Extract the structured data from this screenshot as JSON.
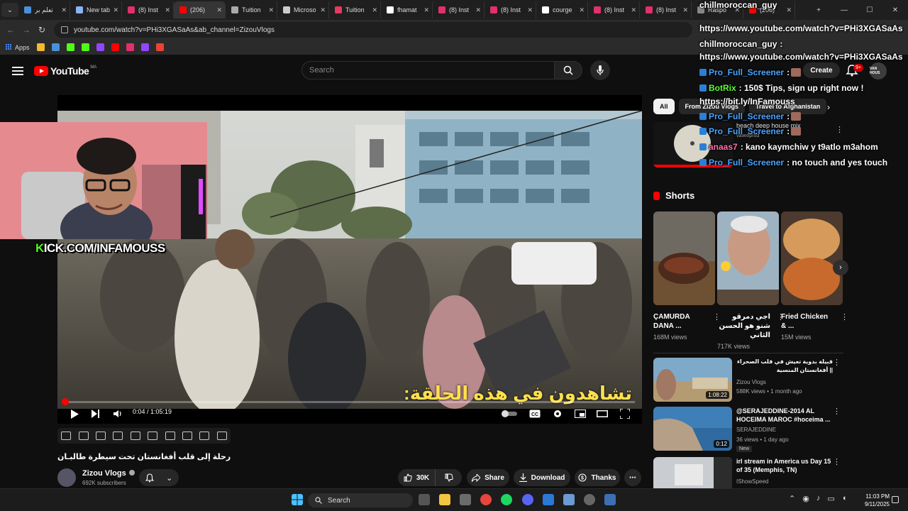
{
  "browser": {
    "tabs": [
      {
        "label": "تعلم بر",
        "color": "#4a90d9"
      },
      {
        "label": "New tab",
        "color": "#8ab4f8"
      },
      {
        "label": "(8) Inst",
        "color": "#e1306c"
      },
      {
        "label": "(206)",
        "color": "#ff0000",
        "active": true
      },
      {
        "label": "Tuition",
        "color": "#aaaaaa"
      },
      {
        "label": "Microso",
        "color": "#cccccc"
      },
      {
        "label": "Tuition",
        "color": "#e33b5f"
      },
      {
        "label": "fhamat",
        "color": "#ffffff"
      },
      {
        "label": "(8) Inst",
        "color": "#e1306c"
      },
      {
        "label": "(8) Inst",
        "color": "#e1306c"
      },
      {
        "label": "courge",
        "color": "#ffffff"
      },
      {
        "label": "(8) Inst",
        "color": "#e1306c"
      },
      {
        "label": "(8) Inst",
        "color": "#e1306c"
      },
      {
        "label": "Raspo",
        "color": "#888888"
      },
      {
        "label": "(206)",
        "color": "#ff0000"
      }
    ],
    "url": "youtube.com/watch?v=PHi3XGASaAs&ab_channel=ZizouVlogs",
    "bookmarks_apps_label": "Apps",
    "bookmark_icons": [
      "#f3ba2f",
      "#4a90d9",
      "#53fc18",
      "#53fc18",
      "#9146ff",
      "#ff0000",
      "#e1306c",
      "#9146ff",
      "#ea4335"
    ]
  },
  "youtube": {
    "logo_word": "YouTube",
    "logo_region": "MA",
    "search_placeholder": "Search",
    "create_label": "Create",
    "notif_badge": "9+",
    "avatar_text": "VAN HOUS"
  },
  "player": {
    "subtitle": "تشاهدون في هذه الحلقة:",
    "time": "0:04 / 1:05:19",
    "progress_fraction": 0.001,
    "kick_text": "KICK.COM/INFAMOUSS",
    "kick_k": "K"
  },
  "video": {
    "title": "رحلة إلى قلب أفغانستان تحت سيطرة طالبـان",
    "channel": "Zizou Vlogs",
    "subscribers": "692K subscribers",
    "likes": "30K",
    "share": "Share",
    "download": "Download",
    "thanks": "Thanks"
  },
  "sidebar": {
    "chips": [
      "All",
      "From Zizou Vlogs",
      "Travel to Afghanistan"
    ],
    "first_rec_title": "beach deep house mix",
    "first_rec_channel": "vascoprod",
    "shorts_label": "Shorts",
    "shorts": [
      {
        "title": "ÇAMURDA DANA ...",
        "views": "168M views"
      },
      {
        "title": "اجي دمرقو شنو هو الحسن الثاني",
        "views": "717K views"
      },
      {
        "title": "Fried Chicken & ...",
        "views": "15M views"
      }
    ],
    "recommended": [
      {
        "title": "قبيلة بدوية تعيش في قلب الصحراء || أفغانستان المنسية",
        "channel": "Zizou Vlogs",
        "meta": "588K views • 1 month ago",
        "duration": "1:08:22",
        "badge": ""
      },
      {
        "title": "@SERAJEDDINE-2014 AL HOCEIMA MAROC #hoceima ...",
        "channel": "SERAJEDDINE",
        "meta": "36 views • 1 day ago",
        "duration": "0:12",
        "badge": "New"
      },
      {
        "title": "irl stream in America us Day 15 of 35 (Memphis, TN)",
        "channel": "IShowSpeed",
        "meta": "",
        "duration": "",
        "badge": ""
      }
    ]
  },
  "chat": [
    {
      "user": "chillmoroccan_guy",
      "text": "",
      "user_class": "none"
    },
    {
      "user": "",
      "text": "https://www.youtube.com/watch?v=PHi3XGASaAs",
      "user_class": "none"
    },
    {
      "user": "chillmoroccan_guy",
      "text": ":",
      "user_class": "none"
    },
    {
      "user": "",
      "text": "https://www.youtube.com/watch?v=PHi3XGASaAs",
      "user_class": "none"
    },
    {
      "user": "Pro_Full_Screener",
      "text": ":",
      "user_class": "blue"
    },
    {
      "user": "BotRix",
      "text": ": 150$ Tips, sign up right now !",
      "user_class": "green"
    },
    {
      "user": "",
      "text": "https://bit.ly/InFamouss",
      "user_class": "none"
    },
    {
      "user": "Pro_Full_Screener",
      "text": ":",
      "user_class": "blue"
    },
    {
      "user": "Pro_Full_Screener",
      "text": ":",
      "user_class": "blue"
    },
    {
      "user": "anaas7",
      "text": ": kano kaymchiw y t9atlo m3ahom",
      "user_class": "pink"
    },
    {
      "user": "Pro_Full_Screener",
      "text": ": no touch and yes touch",
      "user_class": "blue"
    }
  ],
  "taskbar": {
    "search_label": "Search",
    "time": "11:03 PM",
    "date": "9/11/2025"
  }
}
